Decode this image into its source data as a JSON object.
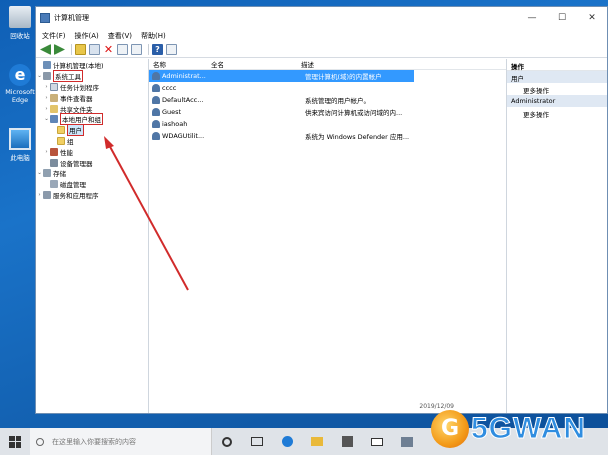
{
  "desktop": {
    "icons": [
      {
        "label": "回收站",
        "icon": "recycle-bin-icon"
      },
      {
        "label": "Microsoft Edge",
        "icon": "edge-icon"
      },
      {
        "label": "此电脑",
        "icon": "this-pc-icon"
      }
    ]
  },
  "window": {
    "title": "计算机管理",
    "controls": {
      "minimize": "—",
      "maximize": "☐",
      "close": "✕"
    }
  },
  "menu": [
    "文件(F)",
    "操作(A)",
    "查看(V)",
    "帮助(H)"
  ],
  "tree": {
    "root": "计算机管理(本地)",
    "system_tools": "系统工具",
    "task_scheduler": "任务计划程序",
    "event_viewer": "事件查看器",
    "shared_folders": "共享文件夹",
    "local_users_groups": "本地用户和组",
    "users": "用户",
    "groups": "组",
    "performance": "性能",
    "device_manager": "设备管理器",
    "storage": "存储",
    "disk_management": "磁盘管理",
    "services_apps": "服务和应用程序"
  },
  "list": {
    "columns": {
      "name": "名称",
      "full_name": "全名",
      "description": "描述"
    },
    "rows": [
      {
        "name": "Administrat...",
        "full_name": "",
        "description": "管理计算机(域)的内置帐户"
      },
      {
        "name": "cccc",
        "full_name": "",
        "description": ""
      },
      {
        "name": "DefaultAcc...",
        "full_name": "",
        "description": "系统管理的用户帐户。"
      },
      {
        "name": "Guest",
        "full_name": "",
        "description": "供来宾访问计算机或访问域的内..."
      },
      {
        "name": "iashoah",
        "full_name": "",
        "description": ""
      },
      {
        "name": "WDAGUtilit...",
        "full_name": "",
        "description": "系统为 Windows Defender 应用..."
      }
    ]
  },
  "actions": {
    "header": "操作",
    "section1": "用户",
    "more1": "更多操作",
    "section2": "Administrator",
    "more2": "更多操作"
  },
  "timestamp": "2019/12/09",
  "taskbar": {
    "search_placeholder": "在这里输入你要搜索的内容"
  },
  "watermark": {
    "logo_letter": "G",
    "text": "5GWAN"
  },
  "colors": {
    "accent": "#3399ff",
    "highlight_red": "#d12b2b",
    "desktop_blue": "#1a73c9"
  }
}
